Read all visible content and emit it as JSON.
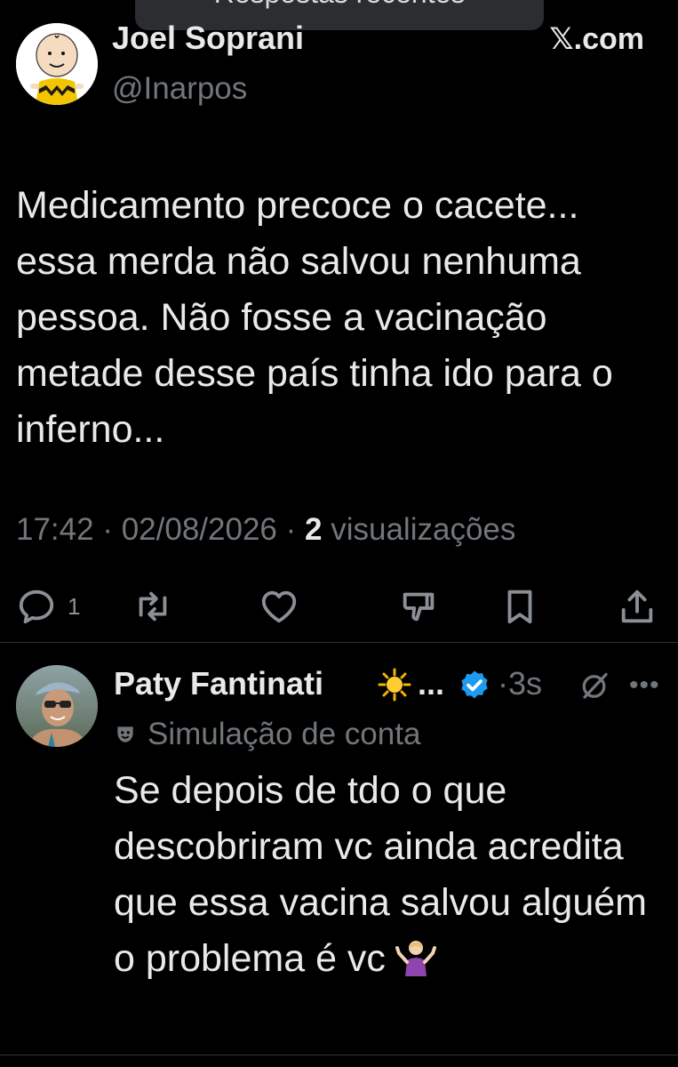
{
  "top_toast": {
    "text": "Respostas recentes"
  },
  "tweet": {
    "author_name": "Joel Soprani",
    "author_handle": "@Inarpos",
    "site": "𝕏.com",
    "text": "Medicamento precoce o cacete... essa merda não salvou nenhuma pessoa. Não fosse a vacinação metade desse país tinha ido para o inferno...",
    "time": "17:42",
    "date": "02/08/2026",
    "separator": "·",
    "views_count": "2",
    "views_label": "visualizações",
    "actions": {
      "reply_count": "1",
      "icons": [
        "reply-icon",
        "retweet-icon",
        "like-icon",
        "dislike-icon",
        "bookmark-icon",
        "share-icon"
      ]
    }
  },
  "reply": {
    "author_name": "Paty Fantinati",
    "name_emoji": "sun",
    "ellipsis": "...",
    "verified": true,
    "time_sep": "·",
    "time": "3s",
    "subtitle": "Simulação de conta",
    "text": "Se depois de tdo o que descobriram vc ainda acredita que essa vacina salvou alguém o problema é vc",
    "trailing_emoji": "person-shrugging"
  },
  "colors": {
    "background": "#000000",
    "text_primary": "#e7e9ea",
    "text_secondary": "#71767b",
    "verified_blue": "#1d9bf0",
    "divider": "#2f3336"
  }
}
